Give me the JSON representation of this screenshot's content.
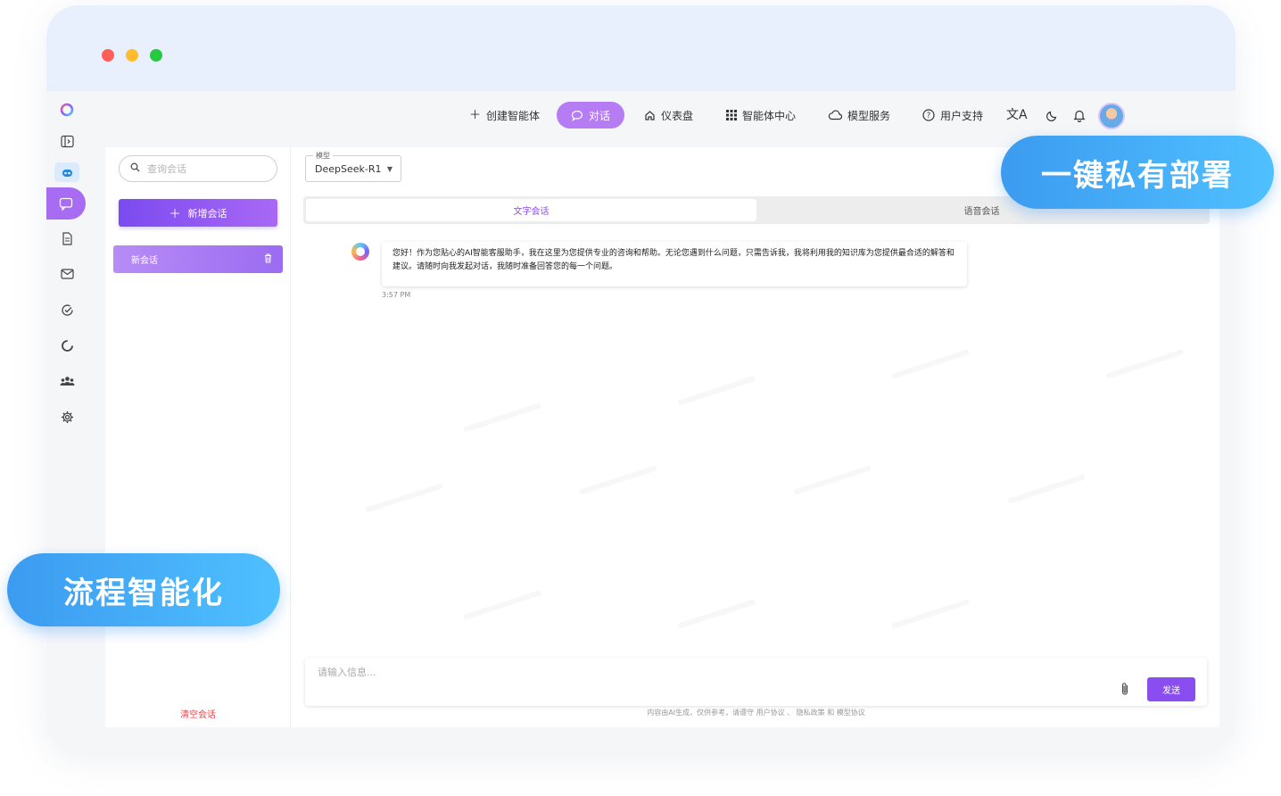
{
  "nav": {
    "create_agent": "创建智能体",
    "chat": "对话",
    "dashboard": "仪表盘",
    "agent_center": "智能体中心",
    "model_service": "模型服务",
    "user_support": "用户支持"
  },
  "sidebar": {
    "search_placeholder": "查询会话",
    "new_chat_label": "新增会话",
    "conversations": [
      {
        "title": "新会话"
      }
    ],
    "clear_label": "清空会话"
  },
  "model_select": {
    "legend": "模型",
    "value": "DeepSeek-R1"
  },
  "tabs": {
    "text": "文字会话",
    "voice": "语音会话"
  },
  "messages": [
    {
      "text": "您好！作为您贴心的AI智能客服助手，我在这里为您提供专业的咨询和帮助。无论您遇到什么问题，只需告诉我，我将利用我的知识库为您提供最合适的解答和建议。请随时向我发起对话，我随时准备回答您的每一个问题。",
      "time": "3:57 PM"
    }
  ],
  "composer": {
    "placeholder": "请输入信息...",
    "send_label": "发送",
    "disclaimer": "内容由AI生成，仅供参考，请遵守 用户协议 、 隐私政策 和 模型协议"
  },
  "badges": {
    "top": "一键私有部署",
    "bottom": "流程智能化"
  },
  "colors": {
    "accent": "#8a4df0",
    "badge_blue": "#3c9bf0",
    "danger": "#e5484d"
  }
}
